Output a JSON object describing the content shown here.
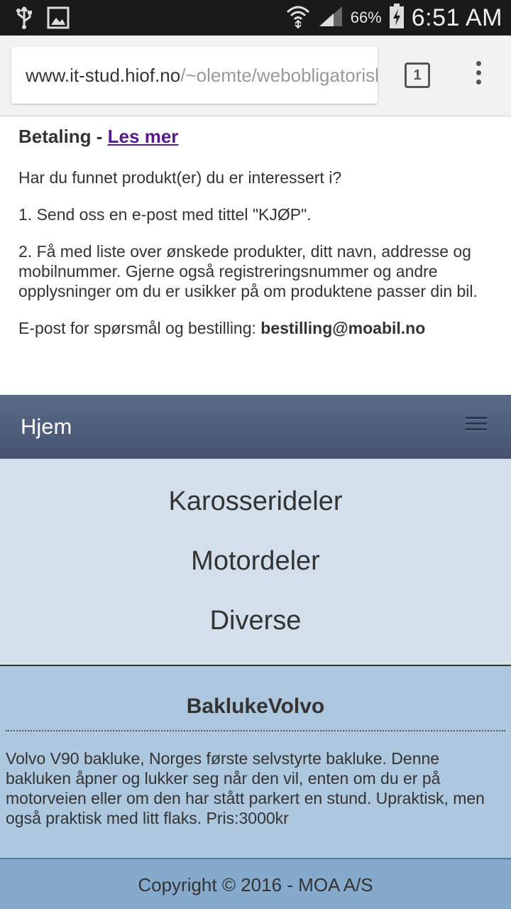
{
  "status_bar": {
    "battery_percent": "66%",
    "time": "6:51 AM",
    "icons": [
      "usb-icon",
      "image-icon",
      "wifi-icon",
      "signal-icon",
      "battery-charging-icon"
    ]
  },
  "browser": {
    "url_host": "www.it-stud.hiof.no",
    "url_path": "/~olemte/webobligatorisk",
    "tab_count": "1"
  },
  "payment": {
    "heading": "Betaling - ",
    "read_more": "Les mer",
    "question": "Har du funnet produkt(er) du er interessert i?",
    "step1": "1. Send oss en e-post med tittel \"KJØP\".",
    "step2": "2. Få med liste over ønskede produkter, ditt navn, addresse og mobilnummer. Gjerne også registreringsnummer og andre opplysninger om du er usikker på om produktene passer din bil.",
    "email_label": "E-post for spørsmål og bestilling: ",
    "email": "bestilling@moabil.no"
  },
  "navbar": {
    "home": "Hjem"
  },
  "menu": {
    "items": [
      "Karosserideler",
      "Motordeler",
      "Diverse"
    ]
  },
  "product": {
    "title": "BaklukeVolvo",
    "description": "Volvo V90 bakluke, Norges første selvstyrte bakluke. Denne bakluken åpner og lukker seg når den vil, enten om du er på motorveien eller om den har stått parkert en stund. Upraktisk, men også praktisk med litt flaks. Pris:3000kr"
  },
  "footer": {
    "copyright": "Copyright © 2016 - MOA A/S"
  },
  "colors": {
    "navbar": "#4f5e7c",
    "menu_bg": "#d3e0ec",
    "product_bg": "#adc7de",
    "footer_bg": "#85aacc",
    "link": "#551a8b"
  }
}
